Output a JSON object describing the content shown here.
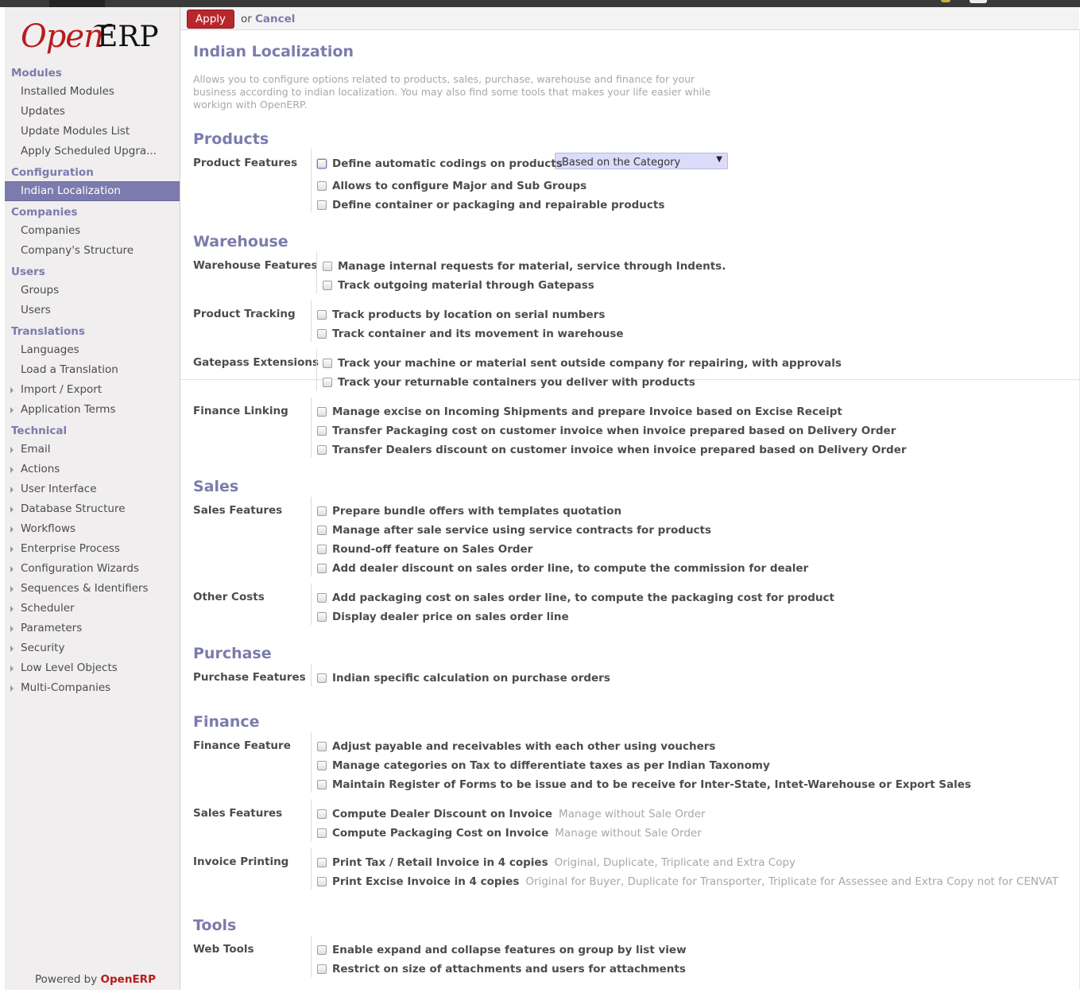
{
  "sidebar": {
    "logo": {
      "open": "Open",
      "erp": "ERP"
    },
    "sections": [
      {
        "header": "Modules",
        "items": [
          {
            "label": "Installed Modules"
          },
          {
            "label": "Updates"
          },
          {
            "label": "Update Modules List"
          },
          {
            "label": "Apply Scheduled Upgra..."
          }
        ]
      },
      {
        "header": "Configuration",
        "items": [
          {
            "label": "Indian Localization",
            "active": true
          }
        ]
      },
      {
        "header": "Companies",
        "items": [
          {
            "label": "Companies"
          },
          {
            "label": "Company's Structure"
          }
        ]
      },
      {
        "header": "Users",
        "items": [
          {
            "label": "Groups"
          },
          {
            "label": "Users"
          }
        ]
      },
      {
        "header": "Translations",
        "items": [
          {
            "label": "Languages"
          },
          {
            "label": "Load a Translation"
          },
          {
            "label": "Import / Export",
            "expandable": true
          },
          {
            "label": "Application Terms",
            "expandable": true
          }
        ]
      },
      {
        "header": "Technical",
        "items": [
          {
            "label": "Email",
            "expandable": true
          },
          {
            "label": "Actions",
            "expandable": true
          },
          {
            "label": "User Interface",
            "expandable": true
          },
          {
            "label": "Database Structure",
            "expandable": true
          },
          {
            "label": "Workflows",
            "expandable": true
          },
          {
            "label": "Enterprise Process",
            "expandable": true
          },
          {
            "label": "Configuration Wizards",
            "expandable": true
          },
          {
            "label": "Sequences & Identifiers",
            "expandable": true
          },
          {
            "label": "Scheduler",
            "expandable": true
          },
          {
            "label": "Parameters",
            "expandable": true
          },
          {
            "label": "Security",
            "expandable": true
          },
          {
            "label": "Low Level Objects",
            "expandable": true
          },
          {
            "label": "Multi-Companies",
            "expandable": true
          }
        ]
      }
    ],
    "powered_by": "Powered by",
    "powered_brand": "OpenERP"
  },
  "toolbar": {
    "apply_label": "Apply",
    "or_text": "or",
    "cancel_label": "Cancel"
  },
  "page": {
    "title": "Indian Localization",
    "description": "Allows you to configure options related to products, sales, purchase, warehouse and finance for your business according to indian localization. You may also find some tools that makes your life easier while workign with OpenERP."
  },
  "select": {
    "value": "Based on the Category",
    "arrow": "▼"
  },
  "sections": [
    {
      "title": "Products",
      "groups": [
        {
          "label": "Product Features",
          "options": [
            {
              "label": "Define automatic codings on products"
            },
            {
              "label": "Allows to configure Major and Sub Groups"
            },
            {
              "label": "Define container or packaging and repairable products"
            }
          ]
        }
      ]
    },
    {
      "title": "Warehouse",
      "groups": [
        {
          "label": "Warehouse Features",
          "options": [
            {
              "label": "Manage internal requests for material, service through Indents."
            },
            {
              "label": "Track outgoing material through Gatepass"
            }
          ]
        },
        {
          "label": "Product Tracking",
          "options": [
            {
              "label": "Track products by location on serial numbers"
            },
            {
              "label": "Track container and its movement in warehouse"
            }
          ]
        },
        {
          "label": "Gatepass Extensions",
          "options": [
            {
              "label": "Track your machine or material sent outside company for repairing, with approvals"
            },
            {
              "label": "Track your returnable containers you deliver with products"
            }
          ]
        },
        {
          "label": "Finance Linking",
          "options": [
            {
              "label": "Manage excise on Incoming Shipments and prepare Invoice based on Excise Receipt"
            },
            {
              "label": "Transfer Packaging cost on customer invoice when invoice prepared based on Delivery Order"
            },
            {
              "label": "Transfer Dealers discount on customer invoice when invoice prepared based on Delivery Order"
            }
          ]
        }
      ]
    },
    {
      "title": "Sales",
      "groups": [
        {
          "label": "Sales Features",
          "options": [
            {
              "label": "Prepare bundle offers with templates quotation"
            },
            {
              "label": "Manage after sale service using service contracts for products"
            },
            {
              "label": "Round-off feature on Sales Order"
            },
            {
              "label": "Add dealer discount on sales order line, to compute the commission for dealer"
            }
          ]
        },
        {
          "label": "Other Costs",
          "options": [
            {
              "label": "Add packaging cost on sales order line, to compute the packaging cost for product"
            },
            {
              "label": "Display dealer price on sales order line"
            }
          ]
        }
      ]
    },
    {
      "title": "Purchase",
      "groups": [
        {
          "label": "Purchase Features",
          "options": [
            {
              "label": "Indian specific calculation on purchase orders"
            }
          ]
        }
      ]
    },
    {
      "title": "Finance",
      "groups": [
        {
          "label": "Finance Feature",
          "options": [
            {
              "label": "Adjust payable and receivables with each other using vouchers"
            },
            {
              "label": "Manage categories on Tax to differentiate taxes as per Indian Taxonomy"
            },
            {
              "label": "Maintain Register of Forms to be issue and to be receive for Inter-State, Intet-Warehouse or Export Sales"
            }
          ]
        },
        {
          "label": "Sales Features",
          "options": [
            {
              "label": "Compute Dealer Discount on Invoice",
              "note": "Manage without Sale Order"
            },
            {
              "label": "Compute Packaging Cost on Invoice",
              "note": "Manage without Sale Order"
            }
          ]
        },
        {
          "label": "Invoice Printing",
          "options": [
            {
              "label": "Print Tax / Retail Invoice in 4 copies",
              "note": "Original, Duplicate, Triplicate and Extra Copy"
            },
            {
              "label": "Print Excise Invoice in 4 copies",
              "note": "Original for Buyer, Duplicate for Transporter, Triplicate for Assessee and Extra Copy not for CENVAT"
            }
          ]
        }
      ]
    },
    {
      "title": "Tools",
      "groups": [
        {
          "label": "Web Tools",
          "options": [
            {
              "label": "Enable expand and collapse features on group by list view"
            },
            {
              "label": "Restrict on size of attachments and users for attachments"
            }
          ]
        }
      ]
    }
  ]
}
